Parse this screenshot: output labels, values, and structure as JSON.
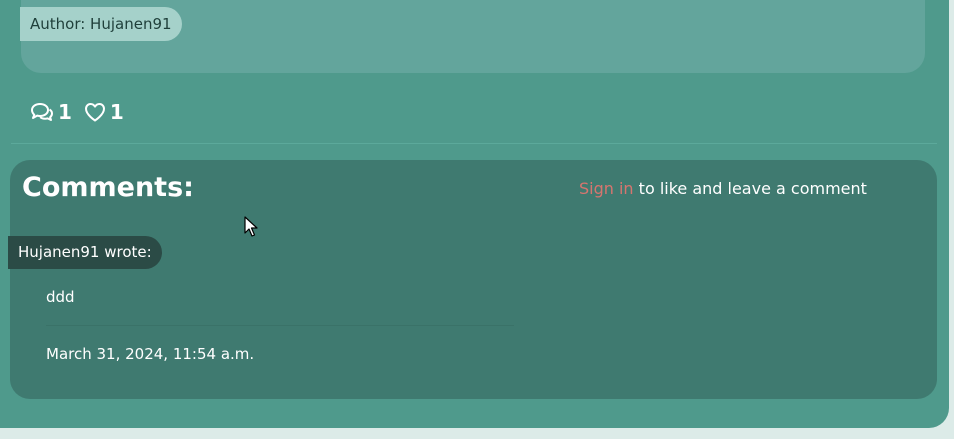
{
  "post": {
    "author_label": "Author: Hujanen91"
  },
  "stats": {
    "comments_count": "1",
    "likes_count": "1",
    "comment_icon": "comment-icon",
    "like_icon": "heart-icon"
  },
  "comments": {
    "title": "Comments:",
    "signin_link": "Sign in",
    "signin_suffix": " to like and leave a comment",
    "items": [
      {
        "author_line": "Hujanen91 wrote:",
        "body": "ddd",
        "date": "March 31, 2024, 11:54 a.m."
      }
    ]
  },
  "colors": {
    "page_bg": "#dcebe8",
    "card_bg": "#4f9a8c",
    "inner_card_bg": "#63a59c",
    "comments_bg": "#3f7a70",
    "author_badge_bg": "#a5d1ca",
    "wrote_badge_bg": "#2b4b46",
    "signin_link": "#d6756f"
  }
}
